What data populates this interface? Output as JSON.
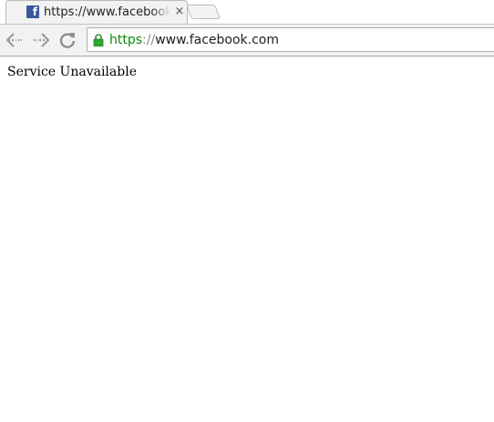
{
  "tab": {
    "title": "https://www.facebook.com",
    "favicon": "facebook-icon",
    "close_glyph": "×"
  },
  "toolbar": {
    "back_icon": "back-arrow-icon",
    "forward_icon": "forward-arrow-icon",
    "reload_icon": "reload-icon"
  },
  "omnibox": {
    "secure_icon": "lock-icon",
    "scheme": "https",
    "separator": "://",
    "host": "www.facebook.com",
    "secure_color": "#0b8a0b"
  },
  "page": {
    "body_text": "Service Unavailable"
  },
  "colors": {
    "facebook_brand": "#3b5998",
    "tab_background": "#f2f2f2",
    "toolbar_background": "#f2f2f2"
  }
}
